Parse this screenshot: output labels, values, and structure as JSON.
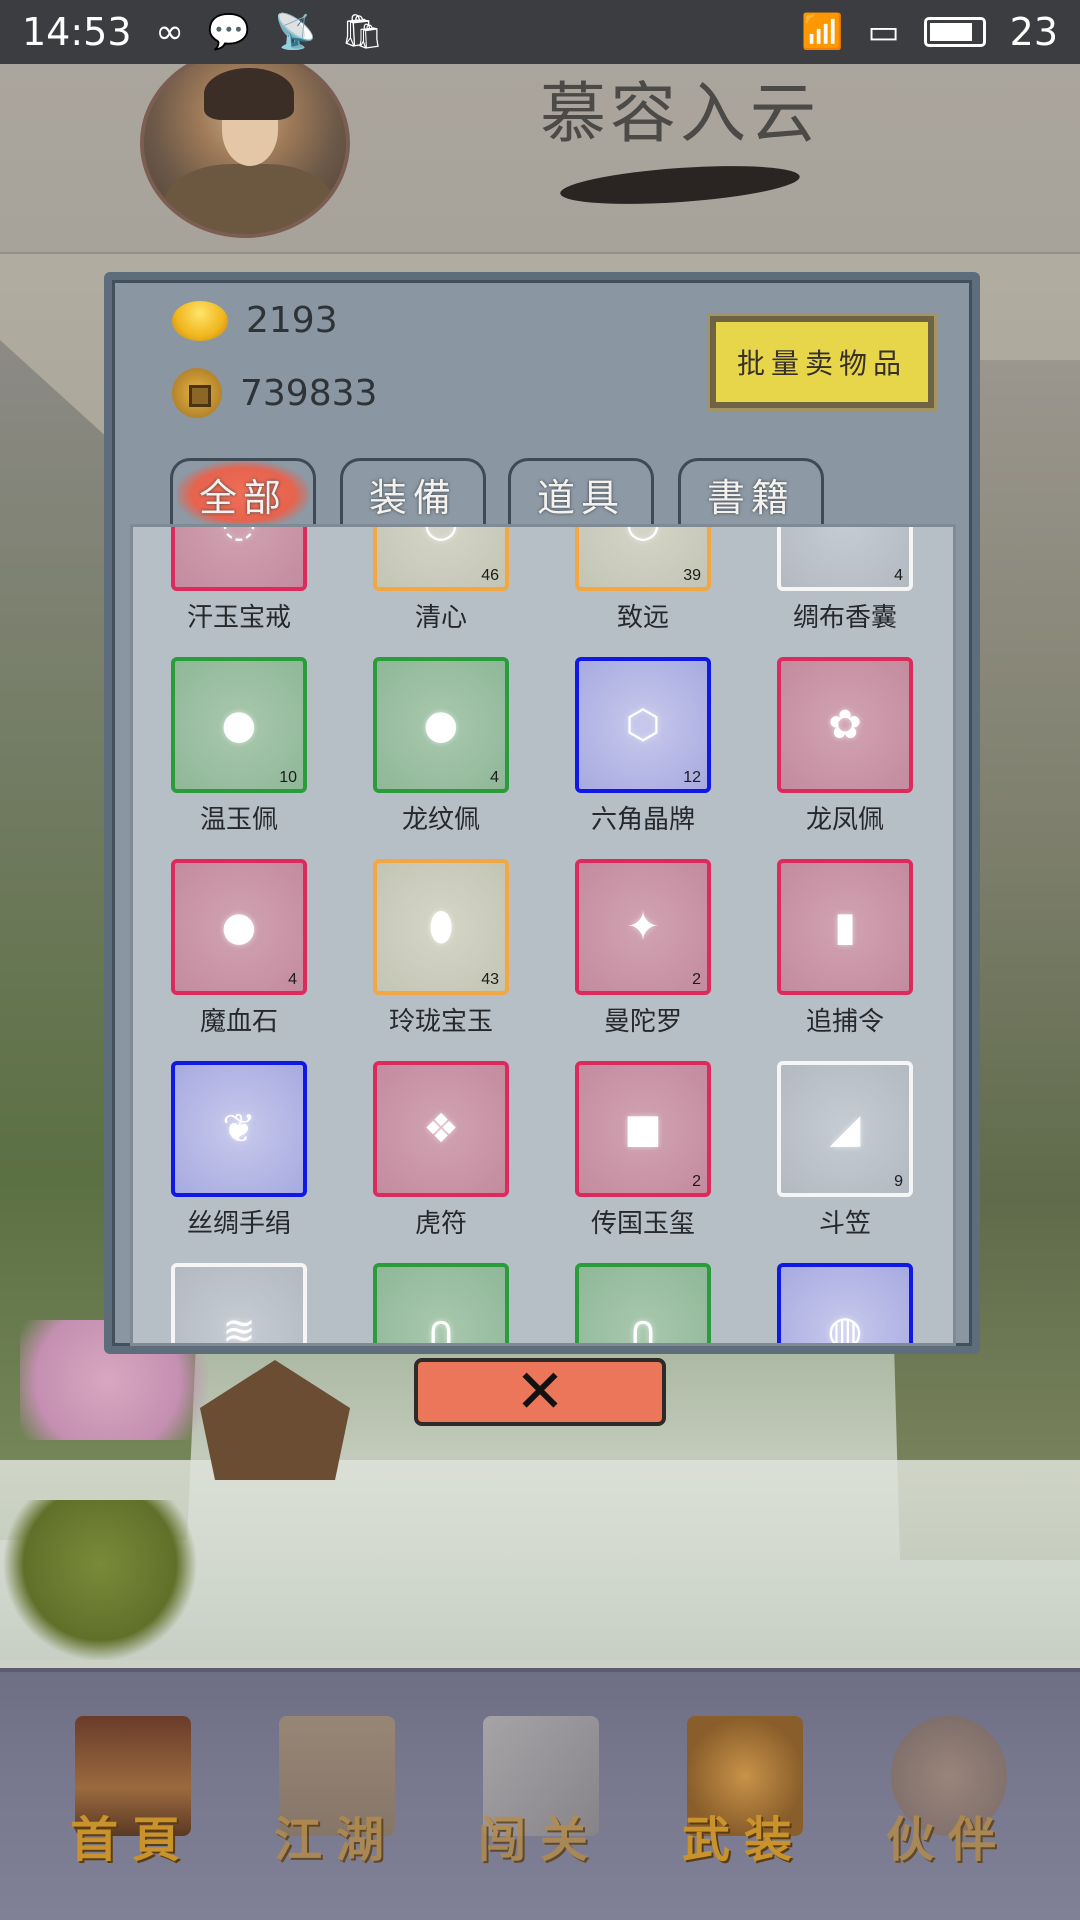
{
  "status_bar": {
    "time": "14:53",
    "battery": "23",
    "left_icons": [
      "infinity-icon",
      "chat-bubble-icon",
      "radio-icon",
      "shopping-bag-icon"
    ],
    "right_icons": [
      "wifi-icon",
      "sim-icon",
      "battery-icon"
    ]
  },
  "header": {
    "player_name": "慕容入云"
  },
  "currency": {
    "ingot": "2193",
    "coins": "739833"
  },
  "sell_button_label": "批量卖物品",
  "tabs": [
    {
      "label": "全部",
      "active": true
    },
    {
      "label": "装備",
      "active": false
    },
    {
      "label": "道具",
      "active": false
    },
    {
      "label": "書籍",
      "active": false
    }
  ],
  "items": [
    {
      "name": "汗玉宝戒",
      "count": "",
      "quality": "red",
      "glyph": "◌"
    },
    {
      "name": "清心",
      "count": "46",
      "quality": "orange",
      "glyph": "◡"
    },
    {
      "name": "致远",
      "count": "39",
      "quality": "orange",
      "glyph": "◡"
    },
    {
      "name": "绸布香囊",
      "count": "4",
      "quality": "white",
      "glyph": "ˈ"
    },
    {
      "name": "温玉佩",
      "count": "10",
      "quality": "green",
      "glyph": "●"
    },
    {
      "name": "龙纹佩",
      "count": "4",
      "quality": "green",
      "glyph": "●"
    },
    {
      "name": "六角晶牌",
      "count": "12",
      "quality": "blue",
      "glyph": "⬡"
    },
    {
      "name": "龙凤佩",
      "count": "",
      "quality": "red",
      "glyph": "✿"
    },
    {
      "name": "魔血石",
      "count": "4",
      "quality": "red",
      "glyph": "●"
    },
    {
      "name": "玲珑宝玉",
      "count": "43",
      "quality": "orange",
      "glyph": "⬮"
    },
    {
      "name": "曼陀罗",
      "count": "2",
      "quality": "red",
      "glyph": "✦"
    },
    {
      "name": "追捕令",
      "count": "",
      "quality": "red",
      "glyph": "▮"
    },
    {
      "name": "丝绸手绢",
      "count": "",
      "quality": "blue",
      "glyph": "❦"
    },
    {
      "name": "虎符",
      "count": "",
      "quality": "red",
      "glyph": "❖"
    },
    {
      "name": "传国玉玺",
      "count": "2",
      "quality": "red",
      "glyph": "■"
    },
    {
      "name": "斗笠",
      "count": "9",
      "quality": "white",
      "glyph": "◢"
    },
    {
      "name": "",
      "count": "",
      "quality": "white",
      "glyph": "≋"
    },
    {
      "name": "",
      "count": "",
      "quality": "green",
      "glyph": "∩"
    },
    {
      "name": "",
      "count": "",
      "quality": "green",
      "glyph": "∩"
    },
    {
      "name": "",
      "count": "",
      "quality": "blue",
      "glyph": "◍"
    }
  ],
  "bottom_nav": [
    {
      "label": "首頁",
      "icon": "house-icon"
    },
    {
      "label": "江湖",
      "icon": "scroll-icon"
    },
    {
      "label": "闯关",
      "icon": "swords-icon"
    },
    {
      "label": "武装",
      "icon": "armor-icon"
    },
    {
      "label": "伙伴",
      "icon": "companions-icon"
    }
  ],
  "colors": {
    "quality_red": "#dc2a5c",
    "quality_orange": "#f3a743",
    "quality_green": "#2a9c3a",
    "quality_blue": "#1018e6",
    "quality_white": "#f5f5f5",
    "close_button": "#ec7659",
    "sell_button": "#e8d64a"
  }
}
